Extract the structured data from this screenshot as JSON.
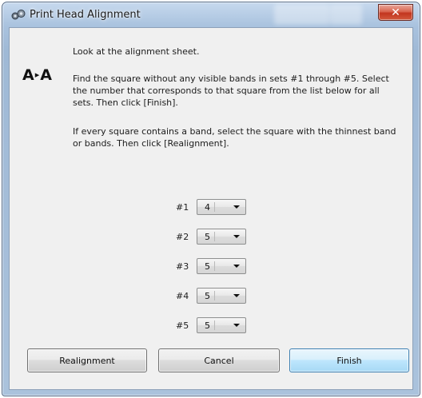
{
  "window": {
    "title": "Print Head Alignment",
    "close_label": "✕"
  },
  "icon": {
    "aa_left": "A",
    "aa_right": "A",
    "aa_arrow": "▸"
  },
  "instructions": {
    "line1": "Look at the alignment sheet.",
    "line2": "Find the square without any visible bands in sets #1 through #5. Select the number that corresponds to that square from the list below for all sets. Then click [Finish].",
    "line3": "If every square contains a band, select the square with the thinnest band or bands. Then click [Realignment]."
  },
  "sets": [
    {
      "label": "#1",
      "value": "4"
    },
    {
      "label": "#2",
      "value": "5"
    },
    {
      "label": "#3",
      "value": "5"
    },
    {
      "label": "#4",
      "value": "5"
    },
    {
      "label": "#5",
      "value": "5"
    }
  ],
  "buttons": {
    "realignment": "Realignment",
    "cancel": "Cancel",
    "finish": "Finish"
  }
}
